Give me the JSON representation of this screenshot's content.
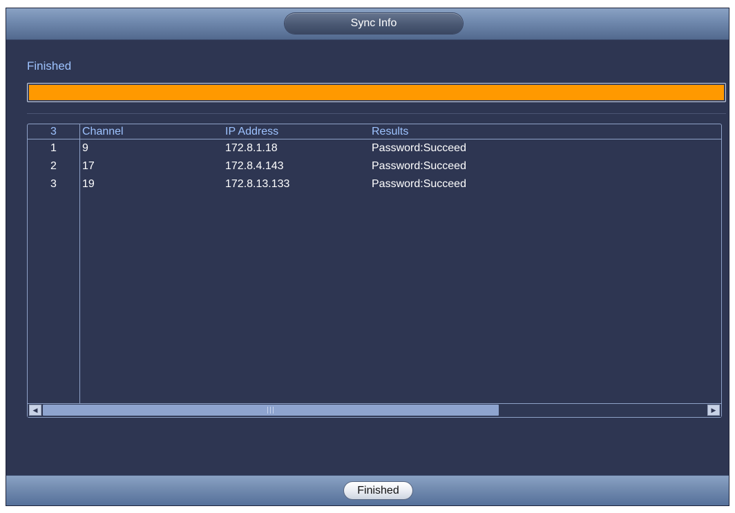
{
  "window": {
    "title": "Sync Info"
  },
  "status": {
    "label": "Finished",
    "progress_percent": 100,
    "progress_color": "#ff9900"
  },
  "table": {
    "headers": {
      "index": "3",
      "channel": "Channel",
      "ip": "IP Address",
      "results": "Results"
    },
    "rows": [
      {
        "index": "1",
        "channel": "9",
        "ip": "172.8.1.18",
        "results": "Password:Succeed"
      },
      {
        "index": "2",
        "channel": "17",
        "ip": "172.8.4.143",
        "results": "Password:Succeed"
      },
      {
        "index": "3",
        "channel": "19",
        "ip": "172.8.13.133",
        "results": "Password:Succeed"
      }
    ],
    "scrollbar": {
      "left_icon": "arrow-left-icon",
      "right_icon": "arrow-right-icon"
    }
  },
  "footer": {
    "button_label": "Finished"
  },
  "colors": {
    "background": "#2e3652",
    "accent_text": "#9ec3ff",
    "bar_gradient": "#6f88ad"
  }
}
